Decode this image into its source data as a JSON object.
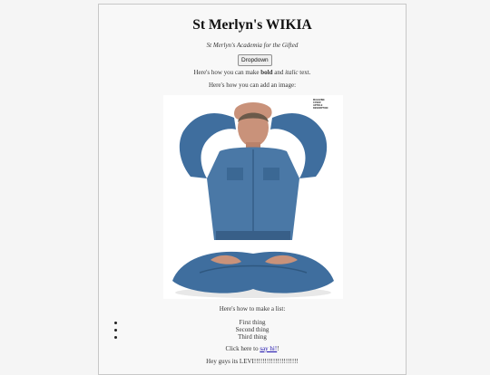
{
  "header": {
    "title": "St Merlyn's WIKIA",
    "subtitle": "St Merlyn's Academia for the Gifted"
  },
  "dropdown": {
    "label": "Dropdown"
  },
  "formatting": {
    "prefix": "Here's how you can make ",
    "bold": "bold",
    "middle": " and ",
    "italic": "italic",
    "suffix": " text."
  },
  "image_section": {
    "intro": "Here's how you can add an image:",
    "caption_lines": [
      "MAGAZINE",
      "COVER",
      "ARTICLE",
      "DESCRIPTION"
    ]
  },
  "list_section": {
    "intro": "Here's how to make a list:",
    "items": [
      "First thing",
      "Second thing",
      "Third thing"
    ]
  },
  "link_section": {
    "prefix": "Click here to ",
    "link_text": "say hi!",
    "suffix": "!"
  },
  "footer": {
    "message": "Hey guys its LEVI!!!!!!!!!!!!!!!!!!!!!"
  },
  "colors": {
    "background": "#f5f5f5",
    "link": "#1a0dab",
    "denim": "#3f6e9e",
    "skin": "#c9927a"
  },
  "icons": []
}
